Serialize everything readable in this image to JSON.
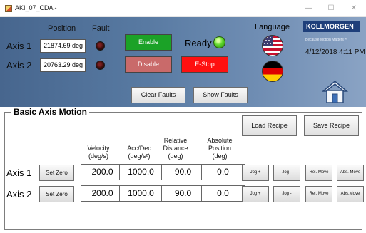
{
  "window": {
    "title": "AKI_07_CDA -",
    "minimize_glyph": "—",
    "maximize_glyph": "☐",
    "close_glyph": "✕"
  },
  "status_panel": {
    "position_header": "Position",
    "fault_header": "Fault",
    "axes": [
      {
        "label": "Axis 1",
        "position": "21874.69 deg"
      },
      {
        "label": "Axis 2",
        "position": "20763.29 deg"
      }
    ],
    "enable_label": "Enable",
    "disable_label": "Disable",
    "estop_label": "E-Stop",
    "ready_label": "Ready",
    "clear_faults_label": "Clear Faults",
    "show_faults_label": "Show Faults"
  },
  "language": {
    "title": "Language",
    "icons": [
      "us-flag-icon",
      "germany-flag-icon"
    ]
  },
  "branding": {
    "logo_text": "KOLLMORGEN",
    "tagline": "Because Motion Matters™",
    "datetime": "4/12/2018 4:11 PM"
  },
  "motion": {
    "title": "Basic Axis Motion",
    "load_recipe_label": "Load Recipe",
    "save_recipe_label": "Save Recipe",
    "headers": {
      "velocity": [
        "Velocity",
        "(deg/s)"
      ],
      "accdec": [
        "Acc/Dec",
        "(deg/s²)"
      ],
      "relative": [
        "Relative",
        "Distance",
        "(deg)"
      ],
      "absolute": [
        "Absolute",
        "Position",
        "(deg)"
      ]
    },
    "rows": [
      {
        "label": "Axis 1",
        "set_zero": "Set Zero",
        "velocity": "200.0",
        "accdec": "1000.0",
        "relative": "90.0",
        "absolute": "0.0",
        "jog_plus": "Jog +",
        "jog_minus": "Jog -",
        "rel_move": "Rel. Move",
        "abs_move": "Abs. Move"
      },
      {
        "label": "Axis 2",
        "set_zero": "Set Zero",
        "velocity": "200.0",
        "accdec": "1000.0",
        "relative": "90.0",
        "absolute": "0.0",
        "jog_plus": "Jog +",
        "jog_minus": "Jog -",
        "rel_move": "Rel. Move",
        "abs_move": "Abs.Move"
      }
    ]
  },
  "colors": {
    "panel_blue": "#587aa2",
    "enable_green": "#1ba227",
    "disable_red": "#c96a6a",
    "estop_red": "#ff1010",
    "ready_led": "#5cd62a",
    "logo_blue": "#1e3f7a"
  },
  "icons": {
    "home": "home-icon",
    "fault_led": "fault-indicator-icon",
    "ready_led": "ready-indicator-icon"
  }
}
